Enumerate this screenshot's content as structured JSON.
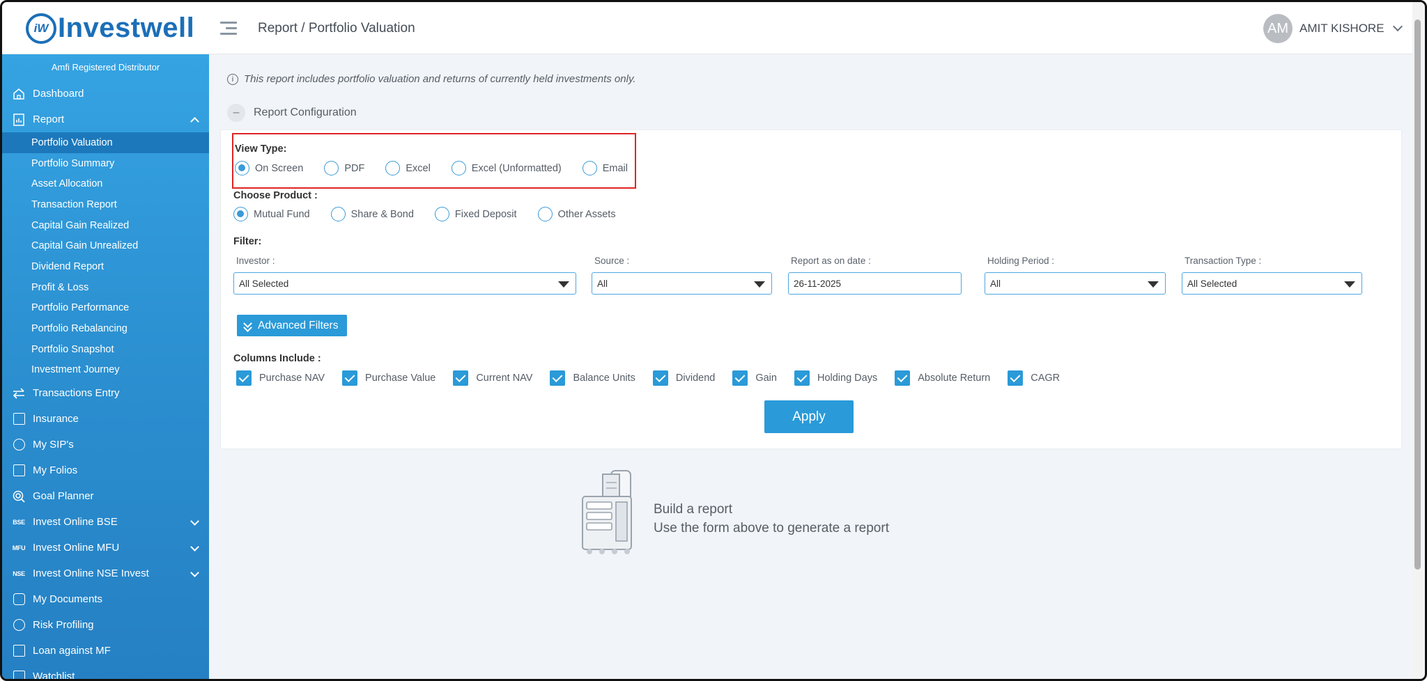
{
  "brand": {
    "mark": "iW",
    "name": "Investwell"
  },
  "header": {
    "breadcrumb": "Report / Portfolio Valuation",
    "user_initials": "AM",
    "user_name": "AMIT KISHORE"
  },
  "sidebar": {
    "badge": "Amfi Registered Distributor",
    "dashboard": "Dashboard",
    "report": "Report",
    "report_items": [
      "Portfolio Valuation",
      "Portfolio Summary",
      "Asset Allocation",
      "Transaction Report",
      "Capital Gain Realized",
      "Capital Gain Unrealized",
      "Dividend Report",
      "Profit & Loss",
      "Portfolio Performance",
      "Portfolio Rebalancing",
      "Portfolio Snapshot",
      "Investment Journey"
    ],
    "transactions_entry": "Transactions Entry",
    "insurance": "Insurance",
    "my_sips": "My SIP's",
    "my_folios": "My Folios",
    "goal_planner": "Goal Planner",
    "bse_tag": "BSE",
    "invest_bse": "Invest Online BSE",
    "mfu_tag": "MFU",
    "invest_mfu": "Invest Online MFU",
    "nse_tag": "NSE",
    "invest_nse": "Invest Online NSE Invest",
    "my_documents": "My Documents",
    "risk_profiling": "Risk Profiling",
    "loan_against_mf": "Loan against MF",
    "watchlist": "Watchlist"
  },
  "main": {
    "notice": "This report includes portfolio valuation and returns of currently held investments only.",
    "config_toggle": "Report Configuration",
    "view_type": {
      "label": "View Type:",
      "options": [
        "On Screen",
        "PDF",
        "Excel",
        "Excel (Unformatted)",
        "Email"
      ],
      "selected": "On Screen"
    },
    "product": {
      "label": "Choose Product :",
      "options": [
        "Mutual Fund",
        "Share & Bond",
        "Fixed Deposit",
        "Other Assets"
      ],
      "selected": "Mutual Fund"
    },
    "filter": {
      "label": "Filter:",
      "investor_label": "Investor :",
      "investor_value": "All Selected",
      "source_label": "Source :",
      "source_value": "All",
      "date_label": "Report as on date :",
      "date_value": "26-11-2025",
      "holding_label": "Holding Period :",
      "holding_value": "All",
      "txn_label": "Transaction Type :",
      "txn_value": "All Selected"
    },
    "advanced_filters": "Advanced Filters",
    "columns": {
      "label": "Columns Include :",
      "items": [
        "Purchase NAV",
        "Purchase Value",
        "Current NAV",
        "Balance Units",
        "Dividend",
        "Gain",
        "Holding Days",
        "Absolute Return",
        "CAGR"
      ]
    },
    "apply": "Apply",
    "empty_title": "Build a report",
    "empty_subtitle": "Use the form above to generate a report"
  },
  "colors": {
    "accent": "#2a9ad8",
    "brand": "#1b6fb8",
    "highlight": "#e02424"
  }
}
